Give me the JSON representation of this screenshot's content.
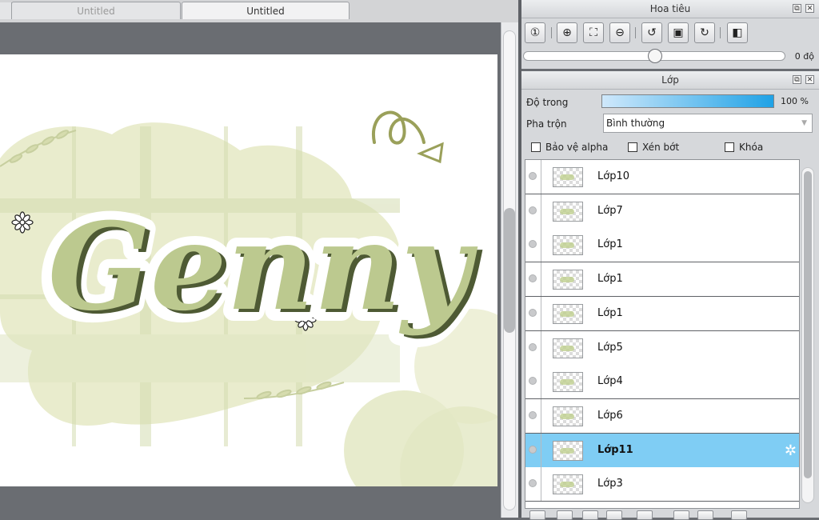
{
  "tabs": [
    {
      "label": "Untitled",
      "active": false
    },
    {
      "label": "Untitled",
      "active": true
    }
  ],
  "canvas": {
    "artwork_text": "Genny",
    "colors": {
      "sage_light": "#e9eccd",
      "sage_mid": "#d4ddb0",
      "sage_dark": "#4e5a34",
      "olive": "#9aa05a"
    }
  },
  "navigator": {
    "title": "Hoa tiêu",
    "rotation_value": "0 độ",
    "tools": [
      "zoom-actual-icon",
      "zoom-in-icon",
      "fit-screen-icon",
      "zoom-out-icon",
      "rotate-left-icon",
      "fit-frame-icon",
      "rotate-right-icon",
      "flip-icon"
    ]
  },
  "layers_panel": {
    "title": "Lớp",
    "opacity_label": "Độ trong",
    "opacity_value": "100 %",
    "blend_label": "Pha trộn",
    "blend_value": "Bình thường",
    "checks": {
      "protect_alpha": "Bảo vệ alpha",
      "clip": "Xén bớt",
      "lock": "Khóa"
    },
    "selected_color": "#7fcdf4",
    "layers": [
      {
        "name": "Lớp10",
        "selected": false
      },
      {
        "name": "Lớp7",
        "selected": false
      },
      {
        "name": "Lớp1",
        "selected": false
      },
      {
        "name": "Lớp1",
        "selected": false
      },
      {
        "name": "Lớp1",
        "selected": false
      },
      {
        "name": "Lớp5",
        "selected": false
      },
      {
        "name": "Lớp4",
        "selected": false
      },
      {
        "name": "Lớp6",
        "selected": false
      },
      {
        "name": "Lớp11",
        "selected": true
      },
      {
        "name": "Lớp3",
        "selected": false
      }
    ]
  }
}
